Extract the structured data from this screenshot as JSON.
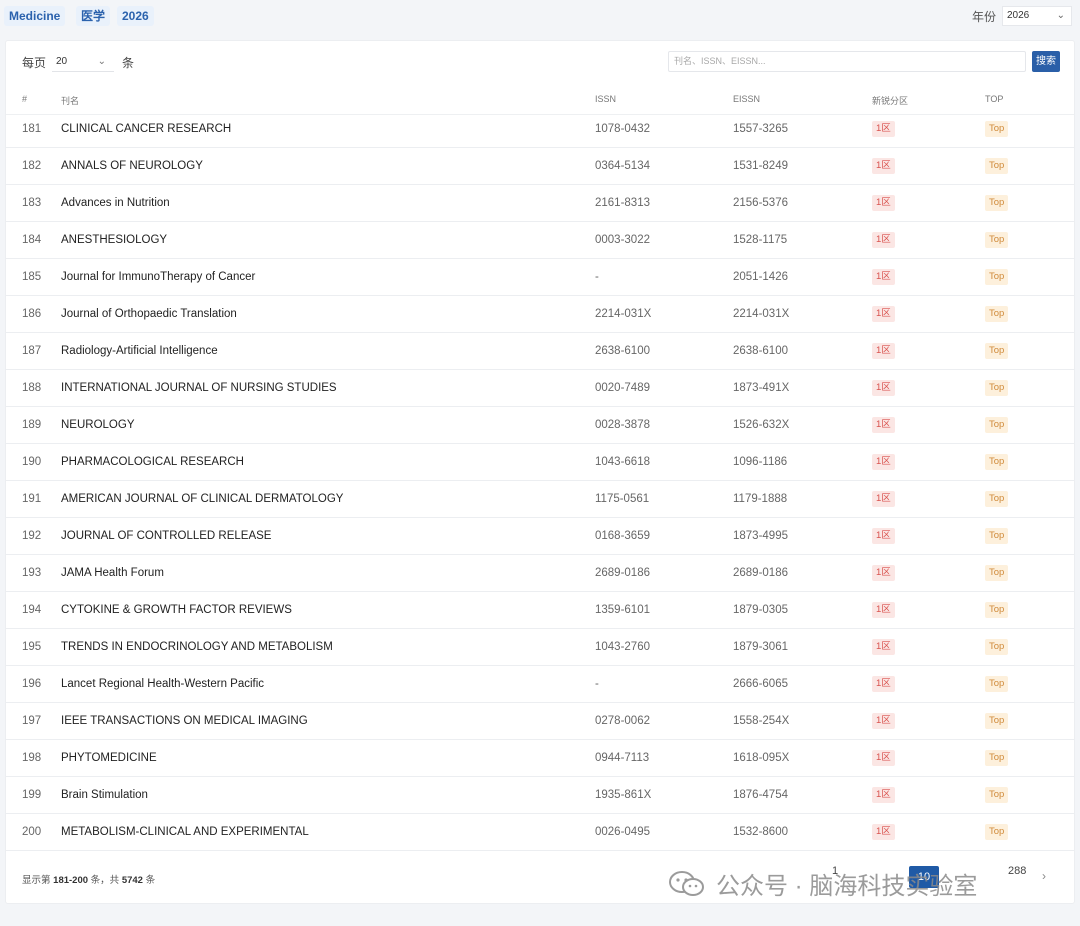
{
  "header": {
    "tags": [
      "Medicine",
      "医学",
      "2026"
    ],
    "year_label": "年份",
    "year_value": "2026"
  },
  "toolbar": {
    "per_page_label": "每页",
    "per_page_value": "20",
    "per_page_unit": "条",
    "search_placeholder": "刊名、ISSN、EISSN...",
    "search_button": "搜索"
  },
  "table": {
    "columns": [
      "#",
      "刊名",
      "ISSN",
      "EISSN",
      "新锐分区",
      "TOP"
    ],
    "rows": [
      {
        "idx": "181",
        "name": "CLINICAL CANCER RESEARCH",
        "issn": "1078-0432",
        "eissn": "1557-3265",
        "zone": "1区",
        "top": "Top"
      },
      {
        "idx": "182",
        "name": "ANNALS OF NEUROLOGY",
        "issn": "0364-5134",
        "eissn": "1531-8249",
        "zone": "1区",
        "top": "Top"
      },
      {
        "idx": "183",
        "name": "Advances in Nutrition",
        "issn": "2161-8313",
        "eissn": "2156-5376",
        "zone": "1区",
        "top": "Top"
      },
      {
        "idx": "184",
        "name": "ANESTHESIOLOGY",
        "issn": "0003-3022",
        "eissn": "1528-1175",
        "zone": "1区",
        "top": "Top"
      },
      {
        "idx": "185",
        "name": "Journal for ImmunoTherapy of Cancer",
        "issn": "-",
        "eissn": "2051-1426",
        "zone": "1区",
        "top": "Top"
      },
      {
        "idx": "186",
        "name": "Journal of Orthopaedic Translation",
        "issn": "2214-031X",
        "eissn": "2214-031X",
        "zone": "1区",
        "top": "Top"
      },
      {
        "idx": "187",
        "name": "Radiology-Artificial Intelligence",
        "issn": "2638-6100",
        "eissn": "2638-6100",
        "zone": "1区",
        "top": "Top"
      },
      {
        "idx": "188",
        "name": "INTERNATIONAL JOURNAL OF NURSING STUDIES",
        "issn": "0020-7489",
        "eissn": "1873-491X",
        "zone": "1区",
        "top": "Top"
      },
      {
        "idx": "189",
        "name": "NEUROLOGY",
        "issn": "0028-3878",
        "eissn": "1526-632X",
        "zone": "1区",
        "top": "Top"
      },
      {
        "idx": "190",
        "name": "PHARMACOLOGICAL RESEARCH",
        "issn": "1043-6618",
        "eissn": "1096-1186",
        "zone": "1区",
        "top": "Top"
      },
      {
        "idx": "191",
        "name": "AMERICAN JOURNAL OF CLINICAL DERMATOLOGY",
        "issn": "1175-0561",
        "eissn": "1179-1888",
        "zone": "1区",
        "top": "Top"
      },
      {
        "idx": "192",
        "name": "JOURNAL OF CONTROLLED RELEASE",
        "issn": "0168-3659",
        "eissn": "1873-4995",
        "zone": "1区",
        "top": "Top"
      },
      {
        "idx": "193",
        "name": "JAMA Health Forum",
        "issn": "2689-0186",
        "eissn": "2689-0186",
        "zone": "1区",
        "top": "Top"
      },
      {
        "idx": "194",
        "name": "CYTOKINE & GROWTH FACTOR REVIEWS",
        "issn": "1359-6101",
        "eissn": "1879-0305",
        "zone": "1区",
        "top": "Top"
      },
      {
        "idx": "195",
        "name": "TRENDS IN ENDOCRINOLOGY AND METABOLISM",
        "issn": "1043-2760",
        "eissn": "1879-3061",
        "zone": "1区",
        "top": "Top"
      },
      {
        "idx": "196",
        "name": "Lancet Regional Health-Western Pacific",
        "issn": "-",
        "eissn": "2666-6065",
        "zone": "1区",
        "top": "Top"
      },
      {
        "idx": "197",
        "name": "IEEE TRANSACTIONS ON MEDICAL IMAGING",
        "issn": "0278-0062",
        "eissn": "1558-254X",
        "zone": "1区",
        "top": "Top"
      },
      {
        "idx": "198",
        "name": "PHYTOMEDICINE",
        "issn": "0944-7113",
        "eissn": "1618-095X",
        "zone": "1区",
        "top": "Top"
      },
      {
        "idx": "199",
        "name": "Brain Stimulation",
        "issn": "1935-861X",
        "eissn": "1876-4754",
        "zone": "1区",
        "top": "Top"
      },
      {
        "idx": "200",
        "name": "METABOLISM-CLINICAL AND EXPERIMENTAL",
        "issn": "0026-0495",
        "eissn": "1532-8600",
        "zone": "1区",
        "top": "Top"
      }
    ]
  },
  "footer": {
    "info_prefix": "显示第",
    "range": "181-200",
    "info_mid": "条，共",
    "total": "5742",
    "info_suffix": "条",
    "pages": {
      "first": "1",
      "current": "10",
      "last": "288"
    },
    "next_arrow": "›"
  },
  "watermark": {
    "text": "公众号 · 脑海科技实验室"
  }
}
